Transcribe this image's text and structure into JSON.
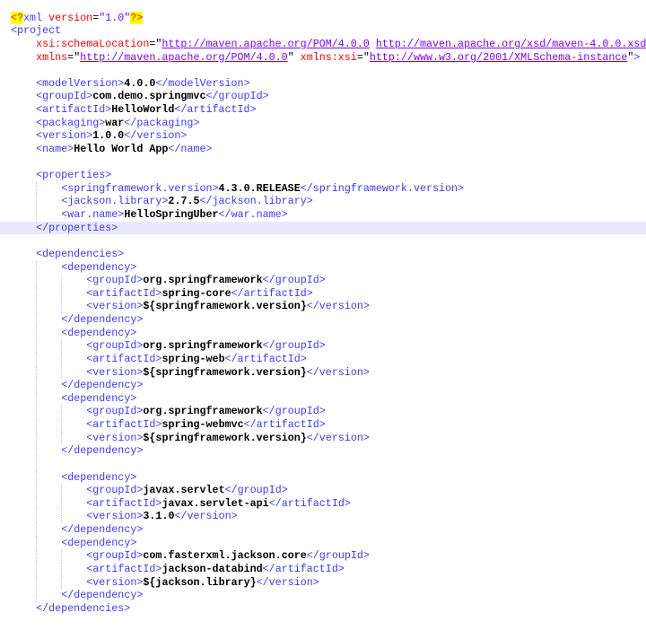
{
  "editor": {
    "current_line": 17,
    "colors": {
      "tag": "#3a3aff",
      "attribute": "#ff0000",
      "value": "#8000ff",
      "text": "#000000",
      "highlight": "#e8e8ff"
    },
    "lines": [
      {
        "indent": 0,
        "tokens": [
          [
            "pi",
            "<?"
          ],
          [
            "tag",
            "xml"
          ],
          [
            "pin",
            " version"
          ],
          [
            "eq",
            "="
          ],
          [
            "val",
            "\"1.0\""
          ],
          [
            "pi",
            "?>"
          ]
        ]
      },
      {
        "indent": 0,
        "tokens": [
          [
            "tag",
            "<project"
          ]
        ]
      },
      {
        "indent": 1,
        "tokens": [
          [
            "attr",
            "xsi:schemaLocation"
          ],
          [
            "eq",
            "="
          ],
          [
            "q",
            "\""
          ],
          [
            "url",
            "http://maven.apache.org/POM/4.0.0"
          ],
          [
            "q",
            " "
          ],
          [
            "url",
            "http://maven.apache.org/xsd/maven-4.0.0.xsd"
          ],
          [
            "q",
            "\""
          ]
        ]
      },
      {
        "indent": 1,
        "tokens": [
          [
            "attr",
            "xmlns"
          ],
          [
            "eq",
            "="
          ],
          [
            "q",
            "\""
          ],
          [
            "url",
            "http://maven.apache.org/POM/4.0.0"
          ],
          [
            "q",
            "\""
          ],
          [
            "attr",
            " xmlns:xsi"
          ],
          [
            "eq",
            "="
          ],
          [
            "q",
            "\""
          ],
          [
            "url",
            "http://www.w3.org/2001/XMLSchema-instance"
          ],
          [
            "q",
            "\""
          ],
          [
            "tag",
            ">"
          ]
        ]
      },
      {
        "indent": 1,
        "tokens": []
      },
      {
        "indent": 1,
        "tokens": [
          [
            "tag",
            "<modelVersion>"
          ],
          [
            "text",
            "4.0.0"
          ],
          [
            "tag",
            "</modelVersion>"
          ]
        ]
      },
      {
        "indent": 1,
        "tokens": [
          [
            "tag",
            "<groupId>"
          ],
          [
            "text",
            "com.demo.springmvc"
          ],
          [
            "tag",
            "</groupId>"
          ]
        ]
      },
      {
        "indent": 1,
        "tokens": [
          [
            "tag",
            "<artifactId>"
          ],
          [
            "text",
            "HelloWorld"
          ],
          [
            "tag",
            "</artifactId>"
          ]
        ]
      },
      {
        "indent": 1,
        "tokens": [
          [
            "tag",
            "<packaging>"
          ],
          [
            "text",
            "war"
          ],
          [
            "tag",
            "</packaging>"
          ]
        ]
      },
      {
        "indent": 1,
        "tokens": [
          [
            "tag",
            "<version>"
          ],
          [
            "text",
            "1.0.0"
          ],
          [
            "tag",
            "</version>"
          ]
        ]
      },
      {
        "indent": 1,
        "tokens": [
          [
            "tag",
            "<name>"
          ],
          [
            "text",
            "Hello World App"
          ],
          [
            "tag",
            "</name>"
          ]
        ]
      },
      {
        "indent": 1,
        "tokens": []
      },
      {
        "indent": 1,
        "tokens": [
          [
            "tag",
            "<properties>"
          ]
        ]
      },
      {
        "indent": 2,
        "tokens": [
          [
            "tag",
            "<springframework.version>"
          ],
          [
            "text",
            "4.3.0.RELEASE"
          ],
          [
            "tag",
            "</springframework.version>"
          ]
        ]
      },
      {
        "indent": 2,
        "tokens": [
          [
            "tag",
            "<jackson.library>"
          ],
          [
            "text",
            "2.7.5"
          ],
          [
            "tag",
            "</jackson.library>"
          ]
        ]
      },
      {
        "indent": 2,
        "tokens": [
          [
            "tag",
            "<war.name>"
          ],
          [
            "text",
            "HelloSpringUber"
          ],
          [
            "tag",
            "</war.name>"
          ]
        ]
      },
      {
        "indent": 1,
        "tokens": [
          [
            "tag",
            "</properties>"
          ]
        ]
      },
      {
        "indent": 1,
        "tokens": []
      },
      {
        "indent": 1,
        "tokens": [
          [
            "tag",
            "<dependencies>"
          ]
        ]
      },
      {
        "indent": 2,
        "tokens": [
          [
            "tag",
            "<dependency>"
          ]
        ]
      },
      {
        "indent": 3,
        "tokens": [
          [
            "tag",
            "<groupId>"
          ],
          [
            "text",
            "org.springframework"
          ],
          [
            "tag",
            "</groupId>"
          ]
        ]
      },
      {
        "indent": 3,
        "tokens": [
          [
            "tag",
            "<artifactId>"
          ],
          [
            "text",
            "spring-core"
          ],
          [
            "tag",
            "</artifactId>"
          ]
        ]
      },
      {
        "indent": 3,
        "tokens": [
          [
            "tag",
            "<version>"
          ],
          [
            "text",
            "${springframework.version}"
          ],
          [
            "tag",
            "</version>"
          ]
        ]
      },
      {
        "indent": 2,
        "tokens": [
          [
            "tag",
            "</dependency>"
          ]
        ]
      },
      {
        "indent": 2,
        "tokens": [
          [
            "tag",
            "<dependency>"
          ]
        ]
      },
      {
        "indent": 3,
        "tokens": [
          [
            "tag",
            "<groupId>"
          ],
          [
            "text",
            "org.springframework"
          ],
          [
            "tag",
            "</groupId>"
          ]
        ]
      },
      {
        "indent": 3,
        "tokens": [
          [
            "tag",
            "<artifactId>"
          ],
          [
            "text",
            "spring-web"
          ],
          [
            "tag",
            "</artifactId>"
          ]
        ]
      },
      {
        "indent": 3,
        "tokens": [
          [
            "tag",
            "<version>"
          ],
          [
            "text",
            "${springframework.version}"
          ],
          [
            "tag",
            "</version>"
          ]
        ]
      },
      {
        "indent": 2,
        "tokens": [
          [
            "tag",
            "</dependency>"
          ]
        ]
      },
      {
        "indent": 2,
        "tokens": [
          [
            "tag",
            "<dependency>"
          ]
        ]
      },
      {
        "indent": 3,
        "tokens": [
          [
            "tag",
            "<groupId>"
          ],
          [
            "text",
            "org.springframework"
          ],
          [
            "tag",
            "</groupId>"
          ]
        ]
      },
      {
        "indent": 3,
        "tokens": [
          [
            "tag",
            "<artifactId>"
          ],
          [
            "text",
            "spring-webmvc"
          ],
          [
            "tag",
            "</artifactId>"
          ]
        ]
      },
      {
        "indent": 3,
        "tokens": [
          [
            "tag",
            "<version>"
          ],
          [
            "text",
            "${springframework.version}"
          ],
          [
            "tag",
            "</version>"
          ]
        ]
      },
      {
        "indent": 2,
        "tokens": [
          [
            "tag",
            "</dependency>"
          ]
        ]
      },
      {
        "indent": 2,
        "tokens": []
      },
      {
        "indent": 2,
        "tokens": [
          [
            "tag",
            "<dependency>"
          ]
        ]
      },
      {
        "indent": 3,
        "tokens": [
          [
            "tag",
            "<groupId>"
          ],
          [
            "text",
            "javax.servlet"
          ],
          [
            "tag",
            "</groupId>"
          ]
        ]
      },
      {
        "indent": 3,
        "tokens": [
          [
            "tag",
            "<artifactId>"
          ],
          [
            "text",
            "javax.servlet-api"
          ],
          [
            "tag",
            "</artifactId>"
          ]
        ]
      },
      {
        "indent": 3,
        "tokens": [
          [
            "tag",
            "<version>"
          ],
          [
            "text",
            "3.1.0"
          ],
          [
            "tag",
            "</version>"
          ]
        ]
      },
      {
        "indent": 2,
        "tokens": [
          [
            "tag",
            "</dependency>"
          ]
        ]
      },
      {
        "indent": 2,
        "tokens": [
          [
            "tag",
            "<dependency>"
          ]
        ]
      },
      {
        "indent": 3,
        "tokens": [
          [
            "tag",
            "<groupId>"
          ],
          [
            "text",
            "com.fasterxml.jackson.core"
          ],
          [
            "tag",
            "</groupId>"
          ]
        ]
      },
      {
        "indent": 3,
        "tokens": [
          [
            "tag",
            "<artifactId>"
          ],
          [
            "text",
            "jackson-databind"
          ],
          [
            "tag",
            "</artifactId>"
          ]
        ]
      },
      {
        "indent": 3,
        "tokens": [
          [
            "tag",
            "<version>"
          ],
          [
            "text",
            "${jackson.library}"
          ],
          [
            "tag",
            "</version>"
          ]
        ]
      },
      {
        "indent": 2,
        "tokens": [
          [
            "tag",
            "</dependency>"
          ]
        ]
      },
      {
        "indent": 1,
        "tokens": [
          [
            "tag",
            "</dependencies>"
          ]
        ]
      }
    ]
  }
}
